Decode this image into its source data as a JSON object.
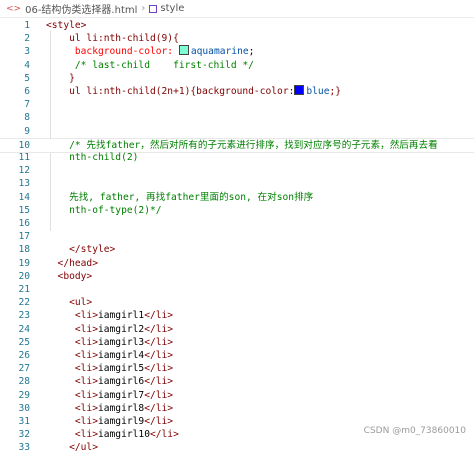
{
  "breadcrumb": {
    "file": "06-结构伪类选择器.html",
    "node": "style"
  },
  "colors": {
    "aquamarine": "#7fffd4",
    "blue": "#0000ff"
  },
  "lines": [
    {
      "n": "1",
      "segs": [
        {
          "t": "<style>",
          "c": "tag"
        }
      ]
    },
    {
      "n": "2",
      "segs": [
        {
          "t": "    ul li:nth-child(9){",
          "c": "sel"
        }
      ]
    },
    {
      "n": "3",
      "segs": [
        {
          "t": "     background-color: ",
          "c": "prop"
        },
        {
          "sw": "aquamarine"
        },
        {
          "t": "aquamarine",
          "c": "val"
        },
        {
          "t": ";",
          "c": "punc"
        }
      ]
    },
    {
      "n": "4",
      "segs": [
        {
          "t": "     /* last-child    first-child */",
          "c": "cmt"
        }
      ]
    },
    {
      "n": "5",
      "segs": [
        {
          "t": "    }",
          "c": "sel"
        }
      ]
    },
    {
      "n": "6",
      "segs": [
        {
          "t": "    ul li:nth-child(2n+1){background-color:",
          "c": "sel"
        },
        {
          "sw": "blue"
        },
        {
          "t": "blue",
          "c": "val"
        },
        {
          "t": ";}",
          "c": "sel"
        }
      ]
    },
    {
      "n": "7",
      "segs": []
    },
    {
      "n": "8",
      "segs": []
    },
    {
      "n": "9",
      "segs": []
    },
    {
      "n": "10",
      "hl": true,
      "segs": [
        {
          "t": "    /* 先找father，然后对所有的子元素进行排序，找到对应序号的子元素，然后再去看",
          "c": "cmt"
        }
      ]
    },
    {
      "n": "11",
      "segs": [
        {
          "t": "    nth-child(2)",
          "c": "cmt"
        }
      ]
    },
    {
      "n": "12",
      "segs": []
    },
    {
      "n": "13",
      "segs": []
    },
    {
      "n": "14",
      "segs": [
        {
          "t": "    先找, father, 再找father里面的son, 在对son排序",
          "c": "cmt"
        }
      ]
    },
    {
      "n": "15",
      "segs": [
        {
          "t": "    nth-of-type(2)*/",
          "c": "cmt"
        }
      ]
    },
    {
      "n": "16",
      "segs": []
    },
    {
      "n": "17",
      "segs": []
    },
    {
      "n": "18",
      "segs": [
        {
          "t": "    </style>",
          "c": "tag"
        }
      ]
    },
    {
      "n": "19",
      "segs": [
        {
          "t": "  </head>",
          "c": "tag"
        }
      ]
    },
    {
      "n": "20",
      "segs": [
        {
          "t": "  <body>",
          "c": "tag"
        }
      ]
    },
    {
      "n": "21",
      "segs": []
    },
    {
      "n": "22",
      "segs": [
        {
          "t": "    <ul>",
          "c": "tag"
        }
      ]
    },
    {
      "n": "23",
      "segs": [
        {
          "t": "     <li>",
          "c": "tag"
        },
        {
          "t": "iamgirl1",
          "c": "txt"
        },
        {
          "t": "</li>",
          "c": "tag"
        }
      ]
    },
    {
      "n": "24",
      "segs": [
        {
          "t": "     <li>",
          "c": "tag"
        },
        {
          "t": "iamgirl2",
          "c": "txt"
        },
        {
          "t": "</li>",
          "c": "tag"
        }
      ]
    },
    {
      "n": "25",
      "segs": [
        {
          "t": "     <li>",
          "c": "tag"
        },
        {
          "t": "iamgirl3",
          "c": "txt"
        },
        {
          "t": "</li>",
          "c": "tag"
        }
      ]
    },
    {
      "n": "26",
      "segs": [
        {
          "t": "     <li>",
          "c": "tag"
        },
        {
          "t": "iamgirl4",
          "c": "txt"
        },
        {
          "t": "</li>",
          "c": "tag"
        }
      ]
    },
    {
      "n": "27",
      "segs": [
        {
          "t": "     <li>",
          "c": "tag"
        },
        {
          "t": "iamgirl5",
          "c": "txt"
        },
        {
          "t": "</li>",
          "c": "tag"
        }
      ]
    },
    {
      "n": "28",
      "segs": [
        {
          "t": "     <li>",
          "c": "tag"
        },
        {
          "t": "iamgirl6",
          "c": "txt"
        },
        {
          "t": "</li>",
          "c": "tag"
        }
      ]
    },
    {
      "n": "29",
      "segs": [
        {
          "t": "     <li>",
          "c": "tag"
        },
        {
          "t": "iamgirl7",
          "c": "txt"
        },
        {
          "t": "</li>",
          "c": "tag"
        }
      ]
    },
    {
      "n": "30",
      "segs": [
        {
          "t": "     <li>",
          "c": "tag"
        },
        {
          "t": "iamgirl8",
          "c": "txt"
        },
        {
          "t": "</li>",
          "c": "tag"
        }
      ]
    },
    {
      "n": "31",
      "segs": [
        {
          "t": "     <li>",
          "c": "tag"
        },
        {
          "t": "iamgirl9",
          "c": "txt"
        },
        {
          "t": "</li>",
          "c": "tag"
        }
      ]
    },
    {
      "n": "32",
      "segs": [
        {
          "t": "     <li>",
          "c": "tag"
        },
        {
          "t": "iamgirl10",
          "c": "txt"
        },
        {
          "t": "</li>",
          "c": "tag"
        }
      ]
    },
    {
      "n": "33",
      "segs": [
        {
          "t": "    </ul>",
          "c": "tag"
        }
      ]
    }
  ],
  "watermark": "CSDN @m0_73860010"
}
